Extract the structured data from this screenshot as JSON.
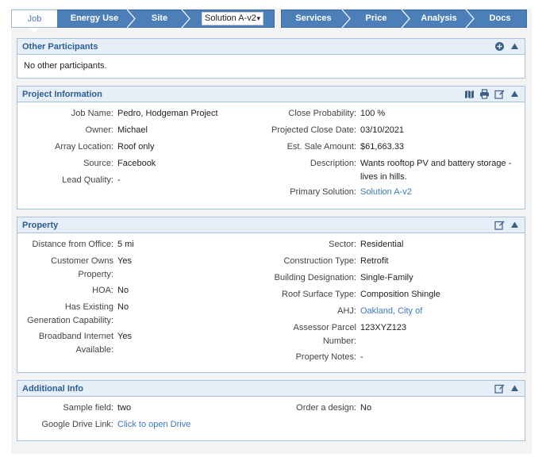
{
  "nav": {
    "tabs_left": [
      "Job",
      "Energy Use",
      "Site"
    ],
    "solution_selected": "Solution A-v2",
    "tabs_right": [
      "Services",
      "Price",
      "Analysis",
      "Docs"
    ]
  },
  "other_participants": {
    "title": "Other Participants",
    "message": "No other participants."
  },
  "project_info": {
    "title": "Project Information",
    "left": [
      {
        "label": "Job Name:",
        "value": "Pedro, Hodgeman Project"
      },
      {
        "label": "Owner:",
        "value": "Michael"
      },
      {
        "label": "Array Location:",
        "value": "Roof only"
      },
      {
        "label": "Source:",
        "value": "Facebook"
      },
      {
        "label": "Lead Quality:",
        "value": "-"
      }
    ],
    "right": [
      {
        "label": "Close Probability:",
        "value": "100 %"
      },
      {
        "label": "Projected Close Date:",
        "value": "03/10/2021"
      },
      {
        "label": "Est. Sale Amount:",
        "value": "$61,663.33"
      },
      {
        "label": "Description:",
        "value": "Wants rooftop PV and battery storage - lives in hills."
      },
      {
        "label": "Primary Solution:",
        "value": "Solution A-v2"
      }
    ]
  },
  "property": {
    "title": "Property",
    "left": [
      {
        "label": "Distance from Office:",
        "value": "5 mi"
      },
      {
        "label": "Customer Owns Property:",
        "value": "Yes"
      },
      {
        "label": "HOA:",
        "value": "No"
      },
      {
        "label": "Has Existing Generation Capability:",
        "value": "No"
      },
      {
        "label": "Broadband Internet Available:",
        "value": "Yes"
      }
    ],
    "right": [
      {
        "label": "Sector:",
        "value": "Residential"
      },
      {
        "label": "Construction Type:",
        "value": "Retrofit"
      },
      {
        "label": "Building Designation:",
        "value": "Single-Family"
      },
      {
        "label": "Roof Surface Type:",
        "value": "Composition Shingle"
      },
      {
        "label": "AHJ:",
        "value": "Oakland, City of"
      },
      {
        "label": "Assessor Parcel Number:",
        "value": "123XYZ123"
      },
      {
        "label": "Property Notes:",
        "value": "-"
      }
    ]
  },
  "additional_info": {
    "title": "Additional Info",
    "left": [
      {
        "label": "Sample field:",
        "value": "two"
      },
      {
        "label": "Google Drive Link:",
        "value": "Click to open Drive"
      }
    ],
    "right": [
      {
        "label": "Order a design:",
        "value": "No"
      }
    ]
  },
  "colors": {
    "nav_blue": "#4c7fb8",
    "panel_title": "#2b5d97",
    "link": "#3a7bc0",
    "panel_header_bg": "#e6eef7"
  }
}
